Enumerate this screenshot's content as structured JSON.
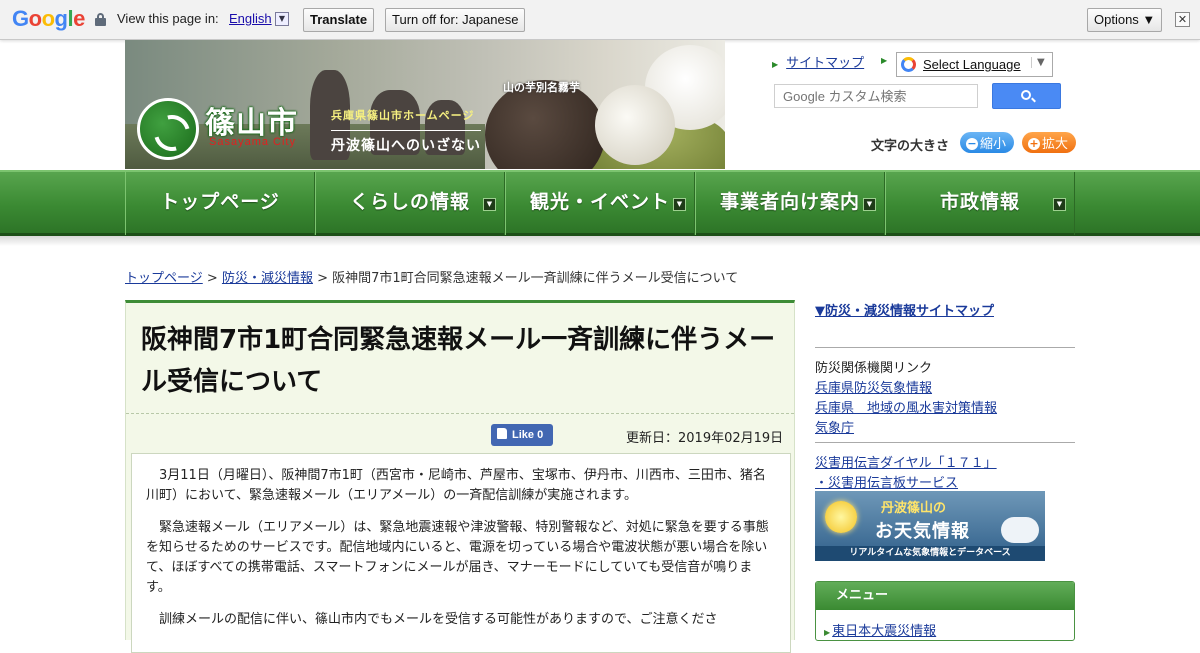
{
  "translate_bar": {
    "logo": "Google",
    "prompt": "View this page in:",
    "language": "English",
    "translate_label": "Translate",
    "turn_off_label": "Turn off for: Japanese",
    "options_label": "Options ▼",
    "close_glyph": "✕"
  },
  "header": {
    "logo_jp": "篠山市",
    "logo_en": "Sasayama City",
    "banner_sub1": "兵庫県篠山市ホームページ",
    "banner_sub2": "丹波篠山へのいざない",
    "banner_potato_label": "山の芋別名霧芋",
    "sitemap_label": "サイトマップ",
    "select_language": "Select Language",
    "search_placeholder": "Google カスタム検索",
    "font_size_label": "文字の大きさ",
    "font_small": "縮小",
    "font_big": "拡大"
  },
  "nav": [
    {
      "label": "トップページ"
    },
    {
      "label": "くらしの情報"
    },
    {
      "label": "観光・イベント"
    },
    {
      "label": "事業者向け案内"
    },
    {
      "label": "市政情報"
    }
  ],
  "breadcrumb": {
    "home": "トップページ",
    "section": "防災・減災情報",
    "current": "阪神間7市1町合同緊急速報メール一斉訓練に伴うメール受信について"
  },
  "article": {
    "title": "阪神間7市1町合同緊急速報メール一斉訓練に伴うメール受信について",
    "like_label": "Like 0",
    "updated": "更新日：2019年02月19日",
    "paragraphs": [
      "3月11日（月曜日）、阪神間7市1町（西宮市・尼崎市、芦屋市、宝塚市、伊丹市、川西市、三田市、猪名川町）において、緊急速報メール（エリアメール）の一斉配信訓練が実施されます。",
      "緊急速報メール（エリアメール）は、緊急地震速報や津波警報、特別警報など、対処に緊急を要する事態を知らせるためのサービスです。配信地域内にいると、電源を切っている場合や電波状態が悪い場合を除いて、ほぼすべての携帯電話、スマートフォンにメールが届き、マナーモードにしていても受信音が鳴ります。",
      "訓練メールの配信に伴い、篠山市内でもメールを受信する可能性がありますので、ご注意くださ"
    ]
  },
  "sidebar": {
    "sitemap": "▼防災・減災情報サイトマップ",
    "links_heading": "防災関係機関リンク",
    "links": [
      "兵庫県防災気象情報",
      "兵庫県　地域の風水害対策情報",
      "気象庁"
    ],
    "dial_link": "災害用伝言ダイヤル「１７１」",
    "board_link": "・災害用伝言板サービス",
    "weather_title1": "丹波篠山の",
    "weather_title2": "お天気情報",
    "weather_sub": "リアルタイムな気象情報とデータベース",
    "menu_heading": "メニュー",
    "menu_item": "東日本大震災情報"
  },
  "colors": {
    "nav_green": "#3b8a33",
    "link_blue": "#1a3a9a",
    "article_bg": "#f3f8e8"
  }
}
